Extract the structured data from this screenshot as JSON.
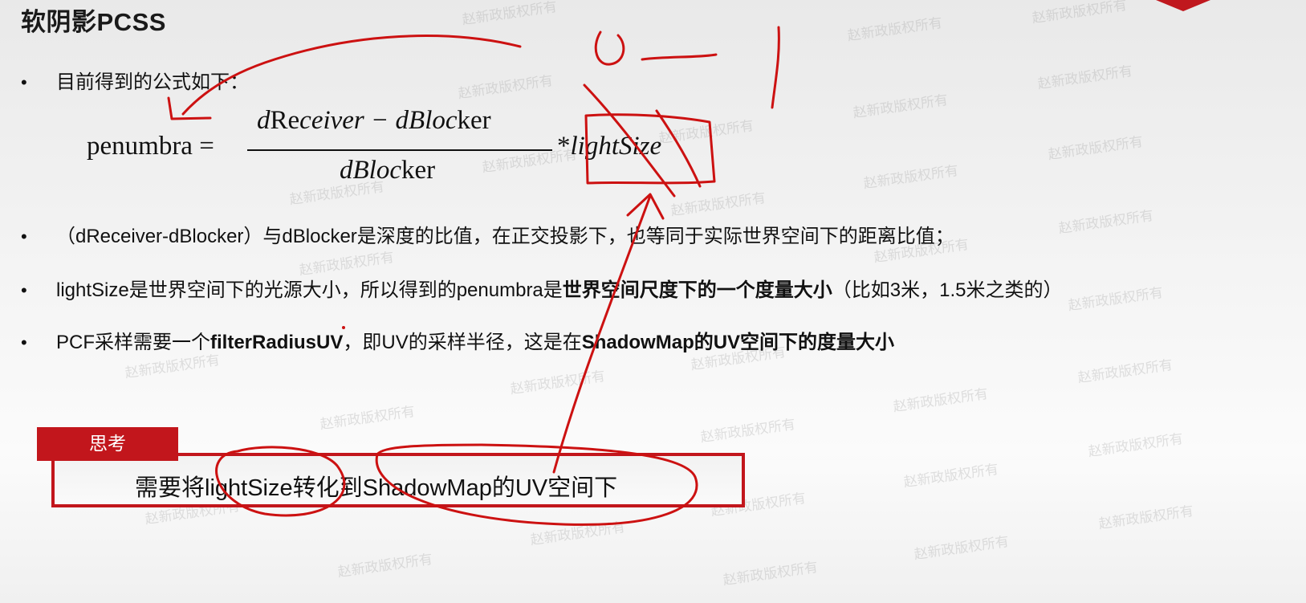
{
  "slide": {
    "title": "软阴影PCSS",
    "bullet_symbol": "•",
    "bullets": [
      {
        "text": "目前得到的公式如下："
      },
      {
        "text": "（dReceiver-dBlocker）与dBlocker是深度的比值，在正交投影下，也等同于实际世界空间下的距离比值；"
      },
      {
        "pre": "lightSize是世界空间下的光源大小，所以得到的penumbra是",
        "bold": "世界空间尺度下的一个度量大小",
        "post": "（比如3米，1.5米之类的）"
      },
      {
        "pre": "PCF采样需要一个",
        "bold": "filterRadiusUV",
        "mid": "，即UV的采样半径，这是在",
        "bold2": "ShadowMap的UV空间下的度量大小"
      }
    ]
  },
  "formula": {
    "lhs": "penumbra =",
    "num_a": "d",
    "num_b": "Re",
    "num_c": "ceiver − dBloc",
    "num_d": "ker",
    "den_a": "dBloc",
    "den_b": "ker",
    "times": "*",
    "rhs": "lightSize"
  },
  "think": {
    "tab_label": "思考",
    "text": "需要将lightSize转化到ShadowMap的UV空间下"
  },
  "watermark": "赵新政版权所有",
  "colors": {
    "accent_red": "#c2161c",
    "annotation_red": "#cc1111"
  }
}
